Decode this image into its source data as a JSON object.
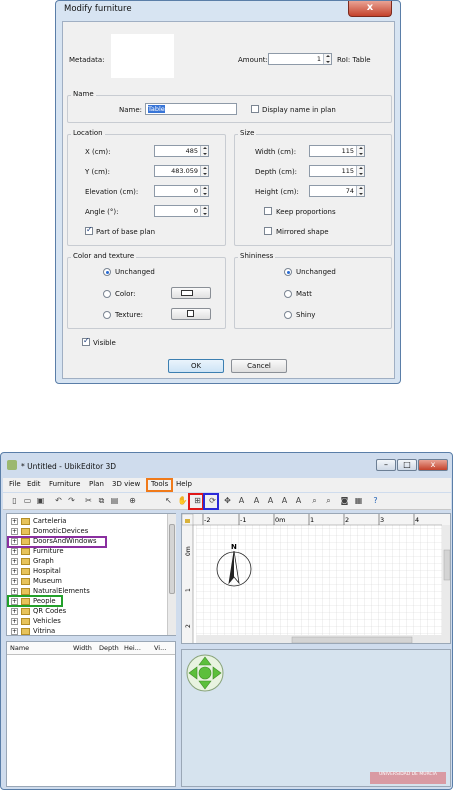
{
  "dialog": {
    "title": "Modify furniture",
    "close": "x",
    "metadata_label": "Metadata:",
    "amount_label": "Amount:",
    "amount_value": "1",
    "roi_label": "RoI: Table",
    "name_group": "Name",
    "name_label": "Name:",
    "name_value": "Table",
    "display_name_label": "Display name in plan",
    "location_group": "Location",
    "x_label": "X (cm):",
    "x_value": "485",
    "y_label": "Y (cm):",
    "y_value": "483.059",
    "elevation_label": "Elevation (cm):",
    "elevation_value": "0",
    "angle_label": "Angle (°):",
    "angle_value": "0",
    "base_plan_label": "Part of base plan",
    "size_group": "Size",
    "width_label": "Width (cm):",
    "width_value": "115",
    "depth_label": "Depth (cm):",
    "depth_value": "115",
    "height_label": "Height (cm):",
    "height_value": "74",
    "keep_proportions_label": "Keep proportions",
    "mirrored_label": "Mirrored shape",
    "color_group": "Color and texture",
    "unchanged_label": "Unchanged",
    "color_label": "Color:",
    "texture_label": "Texture:",
    "shininess_group": "Shininess",
    "shiny_unchanged_label": "Unchanged",
    "matt_label": "Matt",
    "shiny_label": "Shiny",
    "visible_label": "Visible",
    "ok_label": "OK",
    "cancel_label": "Cancel"
  },
  "window": {
    "title": "* Untitled - UbikEditor 3D",
    "controls": [
      "–",
      "□",
      "x"
    ],
    "menu": [
      "File",
      "Edit",
      "Furniture",
      "Plan",
      "3D view",
      "Tools",
      "Help"
    ],
    "tree": [
      "Carteleria",
      "DomoticDevices",
      "DoorsAndWindows",
      "Furniture",
      "Graph",
      "Hospital",
      "Museum",
      "NaturalElements",
      "People",
      "QR Codes",
      "Vehicles",
      "Vitrina"
    ],
    "table_headers": [
      "Name",
      "Width",
      "Depth",
      "Hei...",
      "Vi..."
    ],
    "ruler_labels": [
      "-2",
      "-1",
      "0m",
      "1",
      "2",
      "3",
      "4"
    ],
    "ruler_v_labels": [
      "0m",
      "1",
      "2"
    ],
    "compass_label": "N",
    "logo_text": "UNIVERSIDAD DE MURCIA"
  },
  "colors": {
    "highlight_tools": "#f07a1a",
    "highlight_import": "#e01818",
    "highlight_rotate": "#2a2ad8",
    "highlight_doors": "#8a2fa0",
    "highlight_people": "#22a02a",
    "nav_green": "#5cbf3c"
  }
}
